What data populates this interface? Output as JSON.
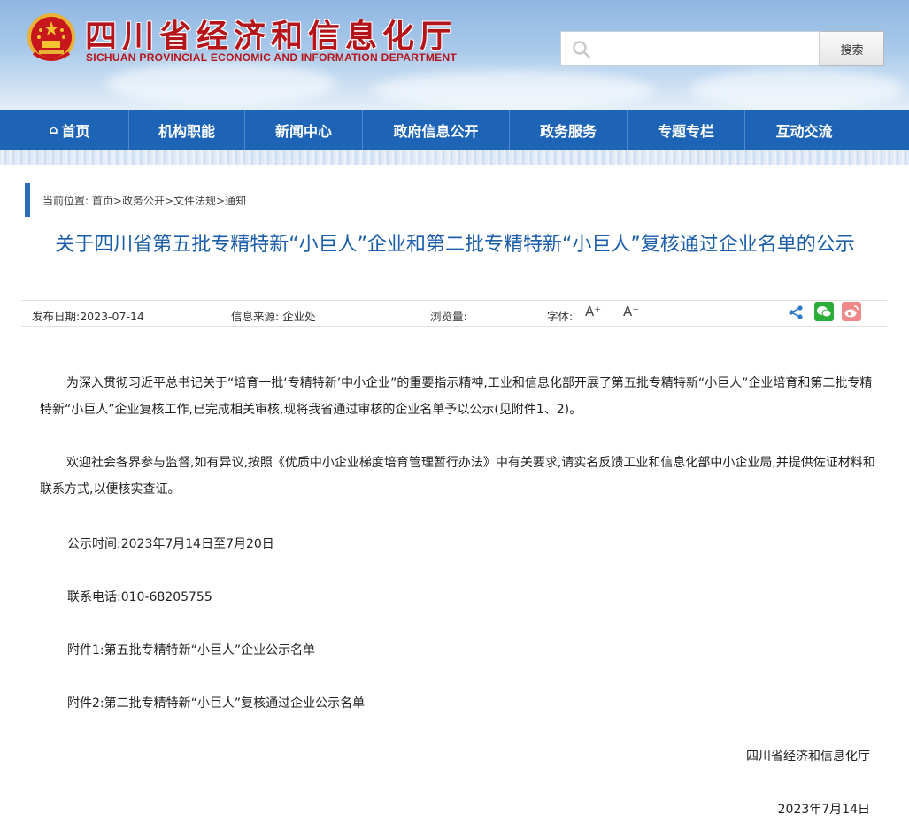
{
  "header": {
    "title": "四川省经济和信息化厅",
    "subtitle": "SICHUAN PROVINCIAL ECONOMIC AND INFORMATION DEPARTMENT",
    "search_placeholder": "",
    "search_button": "搜索"
  },
  "nav": {
    "items": [
      {
        "label": "首页",
        "icon": "home-icon"
      },
      {
        "label": "机构职能"
      },
      {
        "label": "新闻中心"
      },
      {
        "label": "政府信息公开"
      },
      {
        "label": "政务服务"
      },
      {
        "label": "专题专栏"
      },
      {
        "label": "互动交流"
      }
    ]
  },
  "breadcrumb": {
    "prefix": "当前位置: ",
    "items": [
      "首页",
      "政务公开",
      "文件法规",
      "通知"
    ],
    "separator": ">"
  },
  "article": {
    "title": "关于四川省第五批专精特新“小巨人”企业和第二批专精特新“小巨人”复核通过企业名单的公示",
    "meta": {
      "date": "发布日期:2023-07-14",
      "source": "信息来源: 企业处",
      "views": "浏览量:",
      "font_label": "字体:",
      "font_up": "A⁺",
      "font_down": "A⁻"
    },
    "paragraphs": [
      "为深入贯彻习近平总书记关于“培育一批‘专精特新’中小企业”的重要指示精神,工业和信息化部开展了第五批专精特新“小巨人”企业培育和第二批专精特新“小巨人”企业复核工作,已完成相关审核,现将我省通过审核的企业名单予以公示(见附件1、2)。",
      "欢迎社会各界参与监督,如有异议,按照《优质中小企业梯度培育管理暂行办法》中有关要求,请实名反馈工业和信息化部中小企业局,并提供佐证材料和联系方式,以便核实查证。"
    ],
    "period": "公示时间:2023年7月14日至7月20日",
    "phone": "联系电话:010-68205755",
    "attachment1": "附件1:第五批专精特新“小巨人”企业公示名单",
    "attachment2": "附件2:第二批专精特新“小巨人”复核通过企业公示名单",
    "signature": "四川省经济和信息化厅",
    "sign_date": "2023年7月14日"
  },
  "colors": {
    "nav_bg": "#1d63b6",
    "title_blue": "#1c5ea8",
    "brand_red": "#b5141b"
  },
  "icons": [
    "national-emblem-icon",
    "search-icon",
    "home-icon",
    "share-icon",
    "wechat-icon",
    "weibo-icon"
  ]
}
